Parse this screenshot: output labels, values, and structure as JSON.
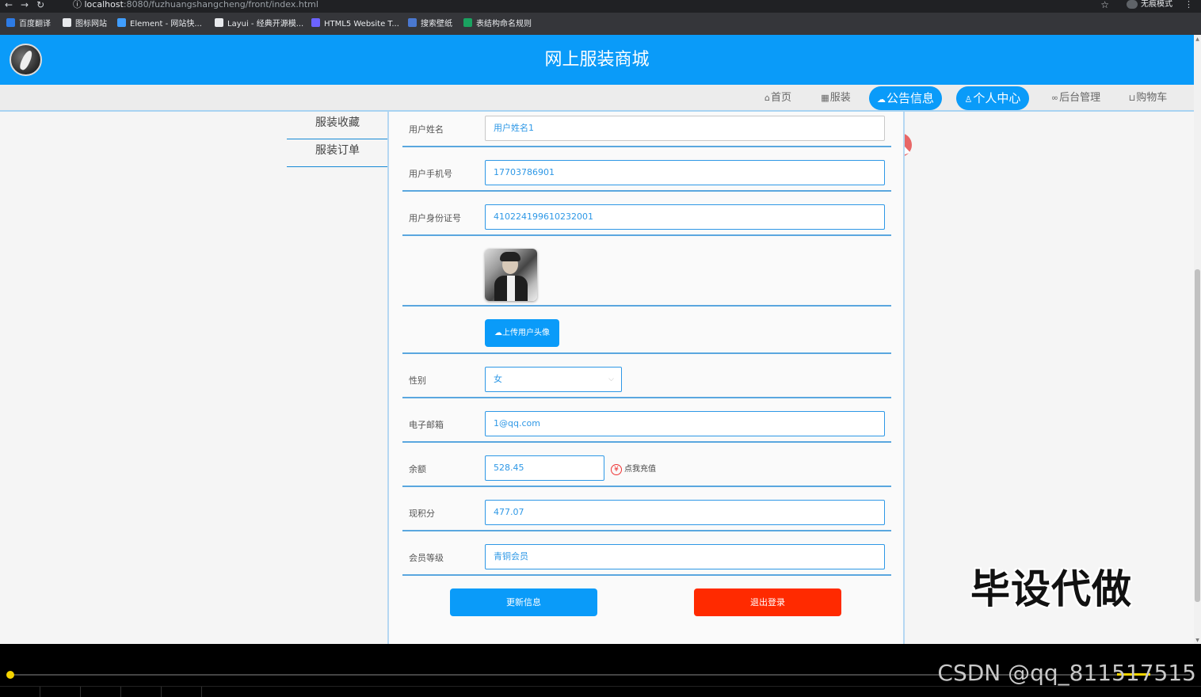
{
  "browser": {
    "url_host": "localhost",
    "url_path": ":8080/fuzhuangshangcheng/front/index.html",
    "incognito_label": "无痕模式",
    "bookmarks": [
      {
        "label": "百度翻译",
        "color": "#2d7be5"
      },
      {
        "label": "图标网站",
        "color": "#e8eaed"
      },
      {
        "label": "Element - 网站快...",
        "color": "#409eff"
      },
      {
        "label": "Layui - 经典开源模...",
        "color": "#e8eaed"
      },
      {
        "label": "HTML5 Website T...",
        "color": "#6c63ff"
      },
      {
        "label": "搜索壁纸",
        "color": "#4a78d0"
      },
      {
        "label": "表结构命名规则",
        "color": "#1aa260"
      }
    ]
  },
  "header": {
    "title": "网上服装商城",
    "brand_color": "#0a9bf9"
  },
  "nav": {
    "items": [
      {
        "icon": "home-icon",
        "glyph": "⌂",
        "label": "首页"
      },
      {
        "icon": "clothes-icon",
        "glyph": "▦",
        "label": "服装"
      },
      {
        "icon": "announcement-icon",
        "glyph": "☁",
        "label": "公告信息"
      },
      {
        "icon": "user-icon",
        "glyph": "♙",
        "label": "个人中心"
      },
      {
        "icon": "link-icon",
        "glyph": "∞",
        "label": "后台管理"
      },
      {
        "icon": "cart-icon",
        "glyph": "⊔",
        "label": "购物车"
      }
    ]
  },
  "sidemenu": {
    "items": [
      "服装收藏",
      "服装订单"
    ]
  },
  "form": {
    "username": {
      "label": "用户姓名",
      "value": "用户姓名1"
    },
    "phone": {
      "label": "用户手机号",
      "value": "17703786901"
    },
    "idcard": {
      "label": "用户身份证号",
      "value": "410224199610232001"
    },
    "upload_label": "上传用户头像",
    "gender": {
      "label": "性别",
      "value": "女"
    },
    "email": {
      "label": "电子邮箱",
      "value": "1@qq.com"
    },
    "balance": {
      "label": "余额",
      "value": "528.45",
      "recharge_label": "点我充值",
      "recharge_icon": "¥"
    },
    "points": {
      "label": "现积分",
      "value": "477.07"
    },
    "level": {
      "label": "会员等级",
      "value": "青铜会员"
    },
    "update_label": "更新信息",
    "logout_label": "退出登录",
    "danger_color": "#ff2a00"
  },
  "overlay": {
    "watermark": "毕设代做",
    "csdn": "CSDN @qq_811517515"
  }
}
